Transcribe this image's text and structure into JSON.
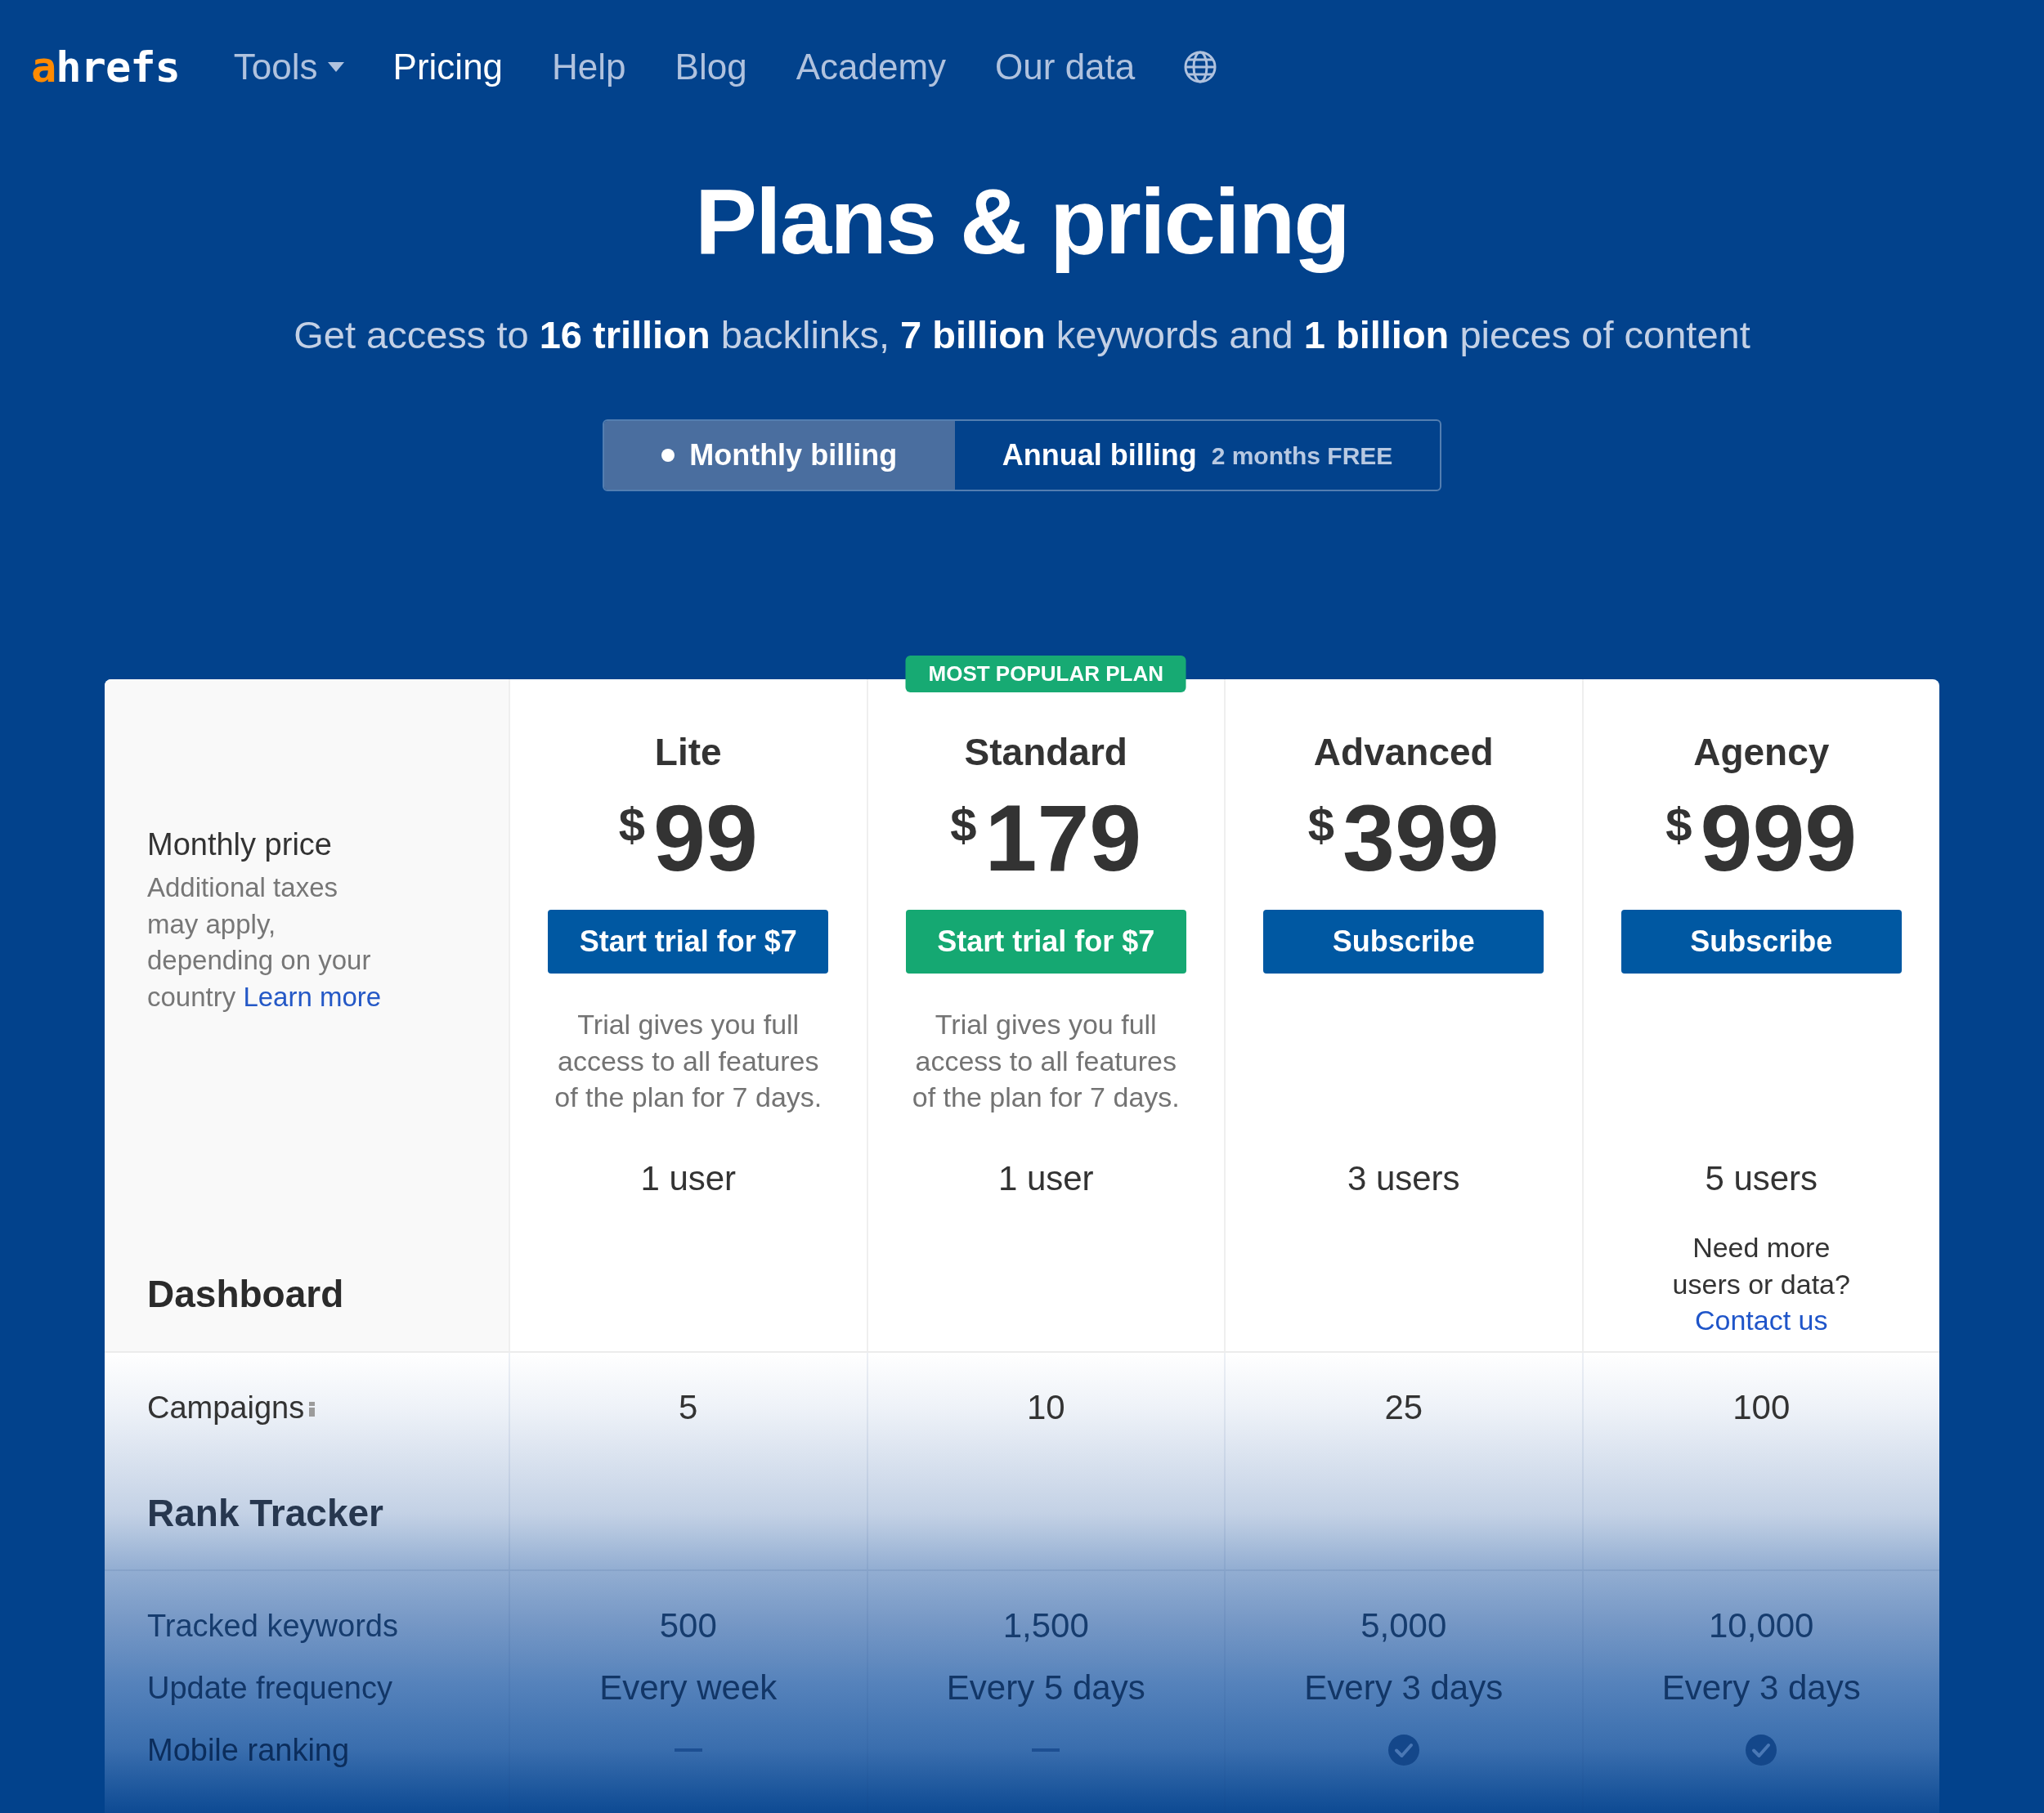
{
  "nav": {
    "logo": {
      "accent": "a",
      "rest": "hrefs"
    },
    "items": [
      {
        "label": "Tools",
        "kind": "dropdown",
        "selected": false
      },
      {
        "label": "Pricing",
        "kind": "link",
        "selected": true
      },
      {
        "label": "Help",
        "kind": "link",
        "selected": false
      },
      {
        "label": "Blog",
        "kind": "link",
        "selected": false
      },
      {
        "label": "Academy",
        "kind": "link",
        "selected": false
      },
      {
        "label": "Our data",
        "kind": "link",
        "selected": false
      }
    ]
  },
  "hero": {
    "title": "Plans & pricing",
    "subtitle": "Get access to **16 trillion** backlinks, **7 billion** keywords and **1 billion** pieces of content"
  },
  "billing": [
    {
      "label": "Monthly billing",
      "selected": true
    },
    {
      "label": "Annual billing",
      "note": "2 months FREE",
      "selected": false
    }
  ],
  "pricing": {
    "label": "Monthly price",
    "note": "Additional taxes may apply, depending on your country",
    "note_link": "Learn more",
    "popular_badge": "MOST POPULAR PLAN",
    "plans": [
      {
        "name": "Lite",
        "currency": "$",
        "price": "99",
        "button": "Start trial for $7",
        "popular": false,
        "trial_note": "Trial gives you full access to all features of the plan for 7 days.",
        "users": "1 user"
      },
      {
        "name": "Standard",
        "currency": "$",
        "price": "179",
        "button": "Start trial for $7",
        "popular": true,
        "trial_note": "Trial gives you full access to all features of the plan for 7 days.",
        "users": "1 user"
      },
      {
        "name": "Advanced",
        "currency": "$",
        "price": "399",
        "button": "Subscribe",
        "popular": false,
        "users": "3 users"
      },
      {
        "name": "Agency",
        "currency": "$",
        "price": "999",
        "button": "Subscribe",
        "popular": false,
        "users": "5 users",
        "contact_note": "Need more users or data?",
        "contact_link": "Contact us"
      }
    ]
  },
  "sections": [
    {
      "title": "Dashboard",
      "rows": [
        {
          "label": "Campaigns",
          "info": true,
          "kind": "text",
          "values": [
            "5",
            "10",
            "25",
            "100"
          ]
        }
      ]
    },
    {
      "title": "Rank Tracker",
      "rows": [
        {
          "label": "Tracked keywords",
          "info": false,
          "kind": "text",
          "values": [
            "500",
            "1,500",
            "5,000",
            "10,000"
          ]
        },
        {
          "label": "Update frequency",
          "info": false,
          "kind": "text",
          "values": [
            "Every week",
            "Every 5 days",
            "Every 3 days",
            "Every 3 days"
          ]
        },
        {
          "label": "Mobile ranking",
          "info": false,
          "kind": "check",
          "checks": [
            false,
            false,
            true,
            true
          ]
        }
      ]
    }
  ]
}
